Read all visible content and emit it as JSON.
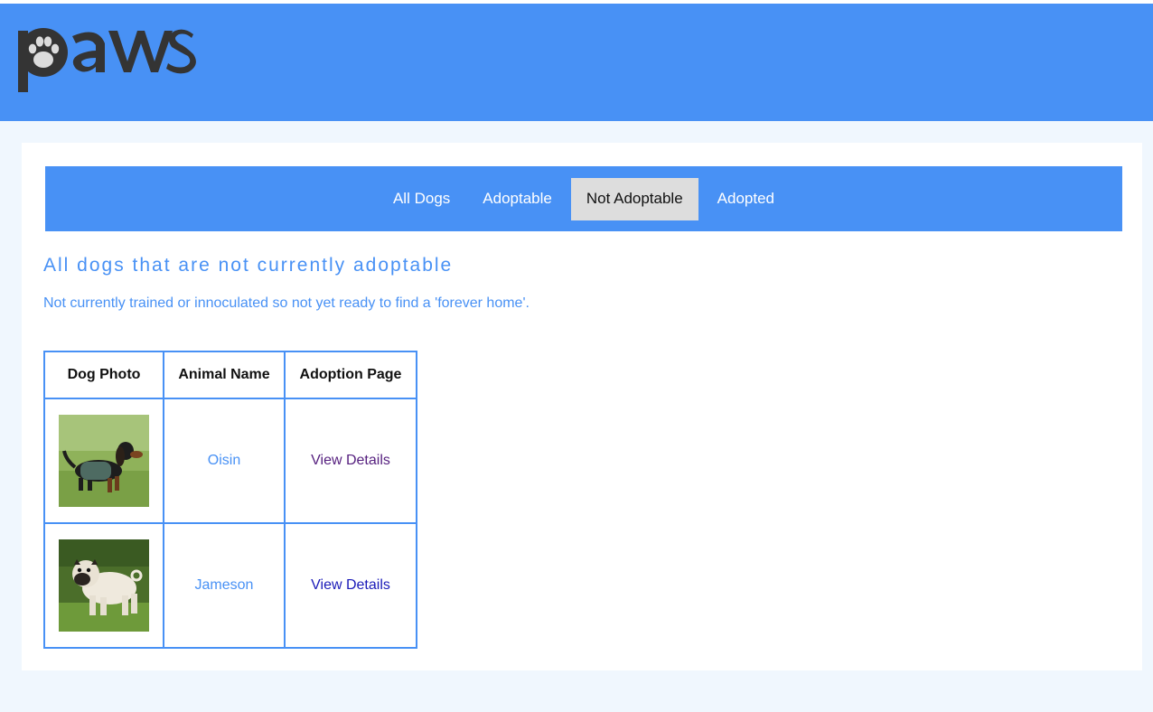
{
  "header": {
    "logo_text": "paws"
  },
  "nav": {
    "items": [
      {
        "label": "All Dogs"
      },
      {
        "label": "Adoptable"
      },
      {
        "label": "Not Adoptable",
        "active": true
      },
      {
        "label": "Adopted"
      }
    ]
  },
  "main": {
    "title": "All dogs that are not currently adoptable",
    "subtitle": "Not currently trained or innoculated so not yet ready to find a 'forever home'."
  },
  "table": {
    "headers": [
      "Dog Photo",
      "Animal Name",
      "Adoption Page"
    ],
    "rows": [
      {
        "name": "Oisin",
        "link": "View Details",
        "visited": true
      },
      {
        "name": "Jameson",
        "link": "View Details",
        "visited": false
      }
    ]
  },
  "colors": {
    "brand_blue": "#4891f5",
    "page_bg": "#f0f7fe",
    "active_tab": "#dddddd",
    "visited_link": "#56207f",
    "link": "#1a1ab8"
  }
}
